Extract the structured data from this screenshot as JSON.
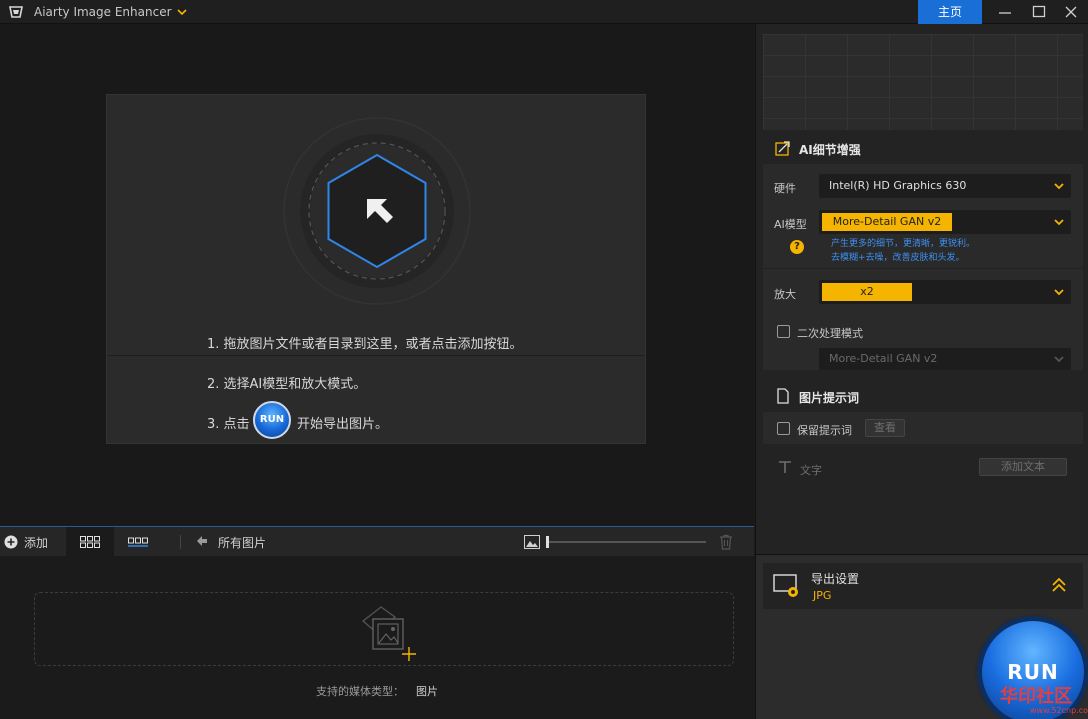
{
  "titlebar": {
    "app_title": "Aiarty Image Enhancer",
    "home_label": "主页"
  },
  "drop_card": {
    "step1": "1. 拖放图片文件或者目录到这里，或者点击添加按钮。",
    "step2": "2. 选择AI模型和放大模式。",
    "step3_pre": "3. 点击",
    "run_label": "RUN",
    "step3_post": "开始导出图片。"
  },
  "toolbar": {
    "add_label": "添加",
    "all_images_label": "所有图片"
  },
  "media": {
    "supported_label": "支持的媒体类型：",
    "supported_value": "图片"
  },
  "ai_section": {
    "header": "AI细节增强",
    "hardware_label": "硬件",
    "hardware_value": "Intel(R) HD Graphics 630",
    "model_label": "AI模型",
    "model_value": "More-Detail GAN v2",
    "model_desc_1": "产生更多的细节，更清晰，更锐利。",
    "model_desc_2": "去模糊+去噪，改善皮肤和头发。",
    "scale_label": "放大",
    "scale_value": "x2",
    "second_pass_label": "二次处理模式",
    "second_pass_model": "More-Detail GAN v2"
  },
  "prompt_section": {
    "header": "图片提示词",
    "keep_label": "保留提示词",
    "view_label": "查看",
    "text_label": "文字",
    "add_text_label": "添加文本"
  },
  "export": {
    "title": "导出设置",
    "format": "JPG",
    "run_label": "RUN"
  },
  "watermark": {
    "text": "华印社区",
    "sub": "www.52cnp.com"
  },
  "colors": {
    "accent_blue": "#1a6fd6",
    "accent_yellow": "#f5b400",
    "desc_blue": "#3d8ff0"
  }
}
